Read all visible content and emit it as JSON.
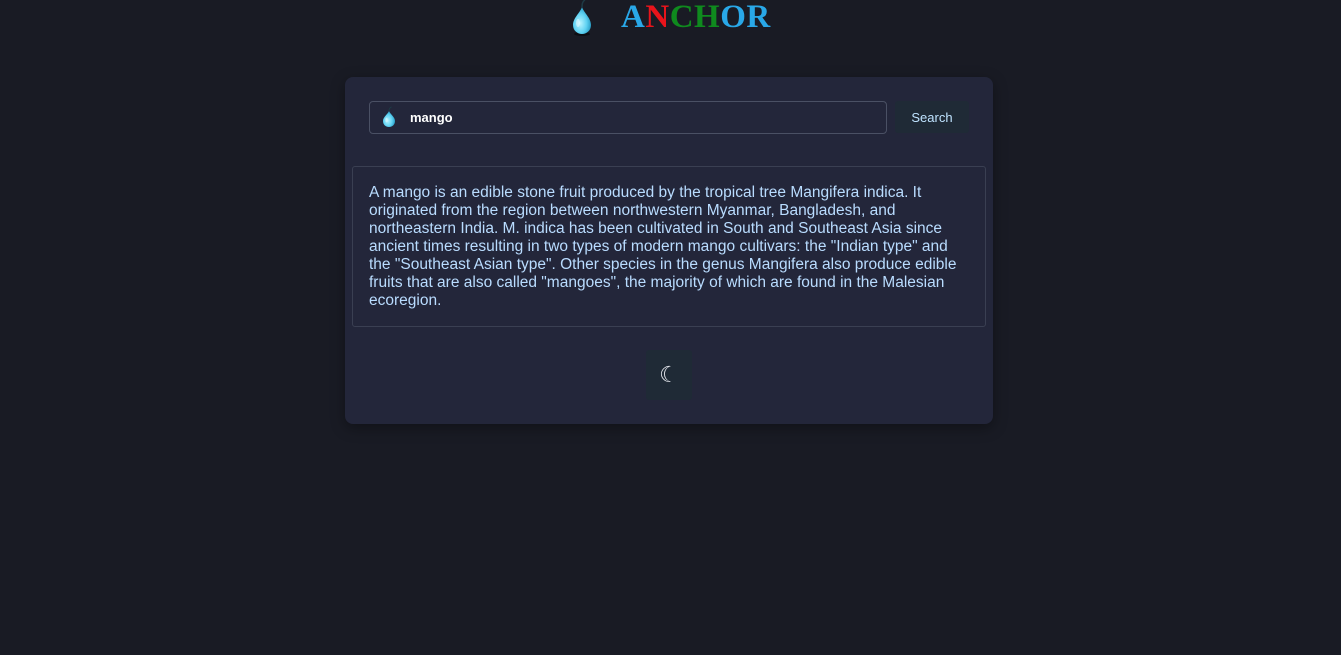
{
  "header": {
    "logo_icon": "pear-drop-icon",
    "brand_letters": [
      {
        "char": "A",
        "color": "#29a8e8"
      },
      {
        "char": "N",
        "color": "#e8141b"
      },
      {
        "char": "C",
        "color": "#0f8a1e"
      },
      {
        "char": "H",
        "color": "#0f8a1e"
      },
      {
        "char": "O",
        "color": "#29a8e8"
      },
      {
        "char": "R",
        "color": "#29a8e8"
      }
    ]
  },
  "search": {
    "icon": "pear-drop-icon",
    "value": "mango",
    "button_label": "Search"
  },
  "result": {
    "text": "A mango is an edible stone fruit produced by the tropical tree Mangifera indica. It originated from the region between northwestern Myanmar, Bangladesh, and northeastern India. M. indica has been cultivated in South and Southeast Asia since ancient times resulting in two types of modern mango cultivars: the \"Indian type\" and the \"Southeast Asian type\". Other species in the genus Mangifera also produce edible fruits that are also called \"mangoes\", the majority of which are found in the Malesian ecoregion."
  },
  "theme_toggle": {
    "icon": "moon-icon",
    "glyph": "☾"
  },
  "colors": {
    "background": "#191b24",
    "card": "#23263a",
    "text": "#b9dcff",
    "button": "#1f2a36"
  }
}
